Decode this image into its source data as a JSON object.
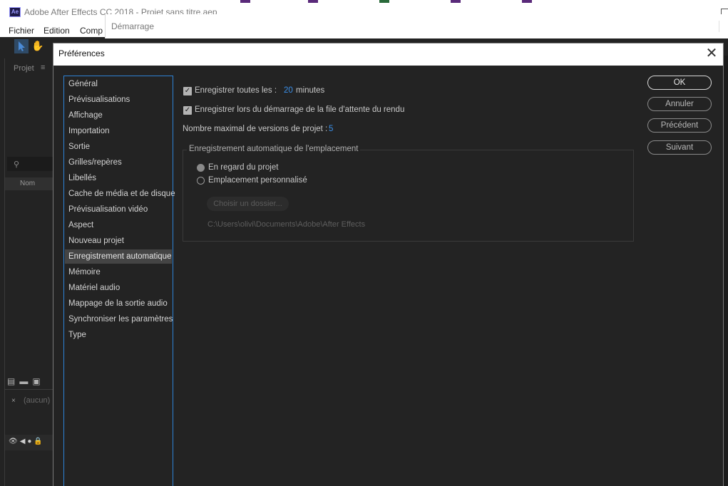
{
  "app": {
    "title": "Adobe After Effects CC 2018 - Projet sans titre.aep",
    "logo": "Ae",
    "menu": [
      "Fichier",
      "Edition",
      "Comp"
    ]
  },
  "left_panel": {
    "tab": "Projet",
    "column_name": "Nom",
    "flowchart_value": "(aucun)"
  },
  "startup_window": {
    "title": "Démarrage"
  },
  "dialog": {
    "title": "Préférences",
    "close_glyph": "✕",
    "categories": [
      "Général",
      "Prévisualisations",
      "Affichage",
      "Importation",
      "Sortie",
      "Grilles/repères",
      "Libellés",
      "Cache de média et de disque",
      "Prévisualisation vidéo",
      "Aspect",
      "Nouveau projet",
      "Enregistrement automatique",
      "Mémoire",
      "Matériel audio",
      "Mappage de la sortie audio",
      "Synchroniser les paramètres",
      "Type"
    ],
    "selected_category": "Enregistrement automatique",
    "autosave": {
      "save_every_label": "Enregistrer toutes les :",
      "save_every_checked": true,
      "save_every_value": "20",
      "save_every_unit": "minutes",
      "save_on_render_label": "Enregistrer lors du démarrage de la file d'attente du rendu",
      "save_on_render_checked": true,
      "max_versions_label": "Nombre maximal de versions de projet :",
      "max_versions_value": "5"
    },
    "location_group": {
      "title": "Enregistrement automatique de l'emplacement",
      "options": [
        "En regard du projet",
        "Emplacement personnalisé"
      ],
      "selected_option": "En regard du projet",
      "choose_folder_label": "Choisir un dossier...",
      "path": "C:\\Users\\olivi\\Documents\\Adobe\\After Effects"
    },
    "buttons": {
      "ok": "OK",
      "cancel": "Annuler",
      "previous": "Précédent",
      "next": "Suivant"
    }
  }
}
